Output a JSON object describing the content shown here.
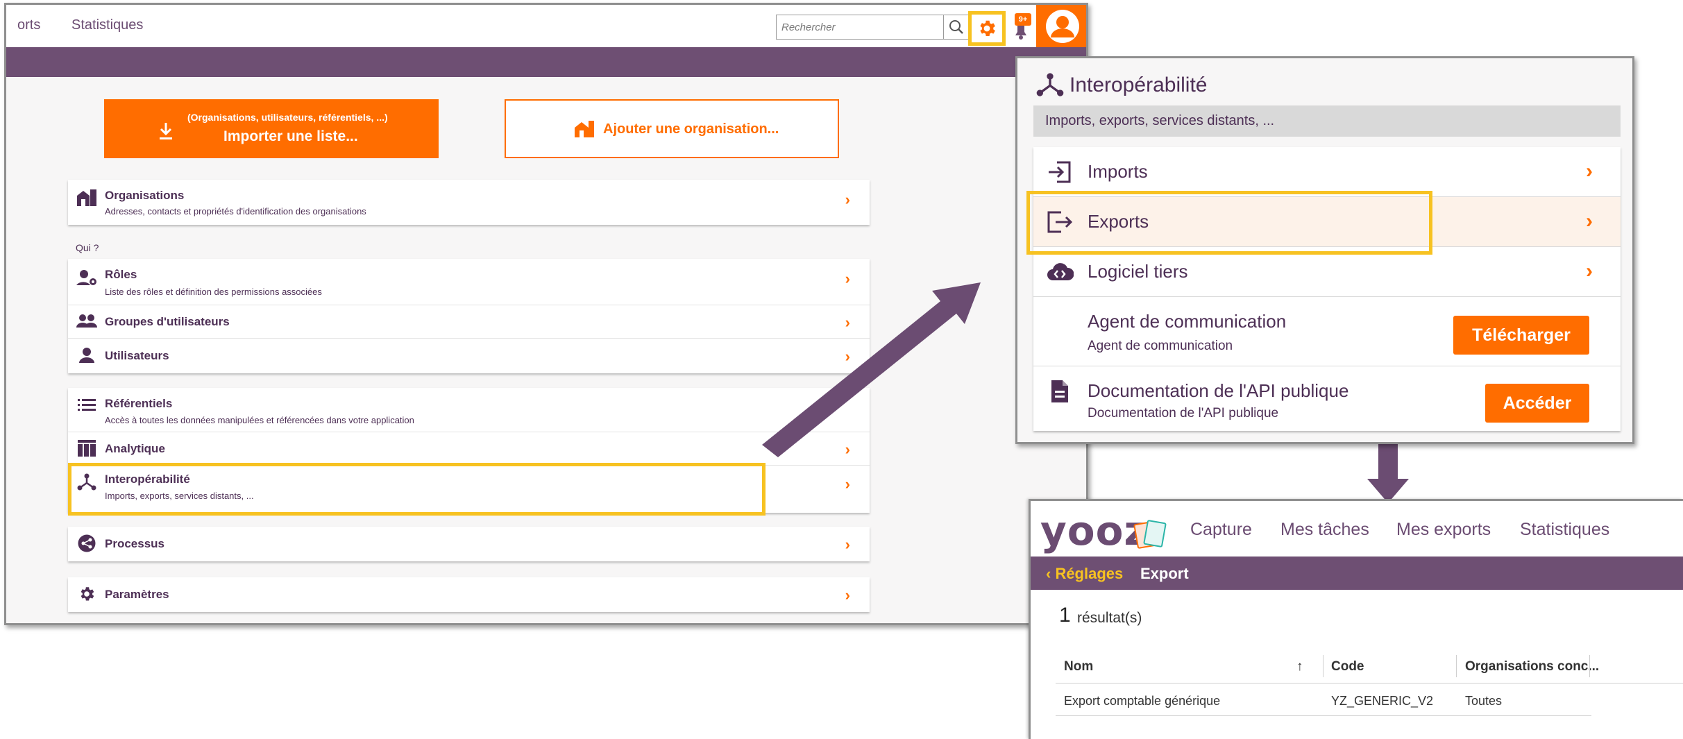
{
  "main": {
    "top_nav": [
      "orts",
      "Statistiques"
    ],
    "search": {
      "placeholder": "Rechercher"
    },
    "notifications_badge": "9+",
    "import_button": {
      "small": "(Organisations, utilisateurs, référentiels, ...)",
      "label": "Importer une liste..."
    },
    "add_org_button": {
      "label": "Ajouter une organisation..."
    },
    "qui_label": "Qui ?",
    "organisations": {
      "title": "Organisations",
      "sub": "Adresses, contacts et propriétés d'identification des organisations"
    },
    "roles": {
      "title": "Rôles",
      "sub": "Liste des rôles et définition des permissions associées"
    },
    "groups": {
      "title": "Groupes d'utilisateurs"
    },
    "users": {
      "title": "Utilisateurs"
    },
    "referentiels": {
      "title": "Référentiels",
      "sub": "Accès à toutes les données manipulées et référencées dans votre application"
    },
    "analytique": {
      "title": "Analytique"
    },
    "interop": {
      "title": "Interopérabilité",
      "sub": "Imports, exports, services distants, ..."
    },
    "processus": {
      "title": "Processus"
    },
    "parametres": {
      "title": "Paramètres"
    },
    "chevron": "›"
  },
  "interop_panel": {
    "title": "Interopérabilité",
    "subtitle": "Imports, exports, services distants, ...",
    "imports": "Imports",
    "exports": "Exports",
    "logiciel": "Logiciel tiers",
    "agent": {
      "title": "Agent de communication",
      "sub": "Agent de communication",
      "button": "Télécharger"
    },
    "doc": {
      "title": "Documentation de l'API publique",
      "sub": "Documentation de l'API publique",
      "button": "Accéder"
    }
  },
  "yooz": {
    "logo": "yooz",
    "nav": [
      "Capture",
      "Mes tâches",
      "Mes exports",
      "Statistiques"
    ],
    "back": "‹ Réglages",
    "crumb": "Export",
    "count": "1",
    "count_label": "résultat(s)",
    "columns": [
      "Nom",
      "Code",
      "Organisations conc..."
    ],
    "sort_icon": "↑",
    "rows": [
      {
        "nom": "Export comptable générique",
        "code": "YZ_GENERIC_V2",
        "orgs": "Toutes"
      }
    ]
  },
  "colors": {
    "orange": "#ff6d00",
    "purple": "#6e4f73",
    "highlight": "#f7c221"
  }
}
